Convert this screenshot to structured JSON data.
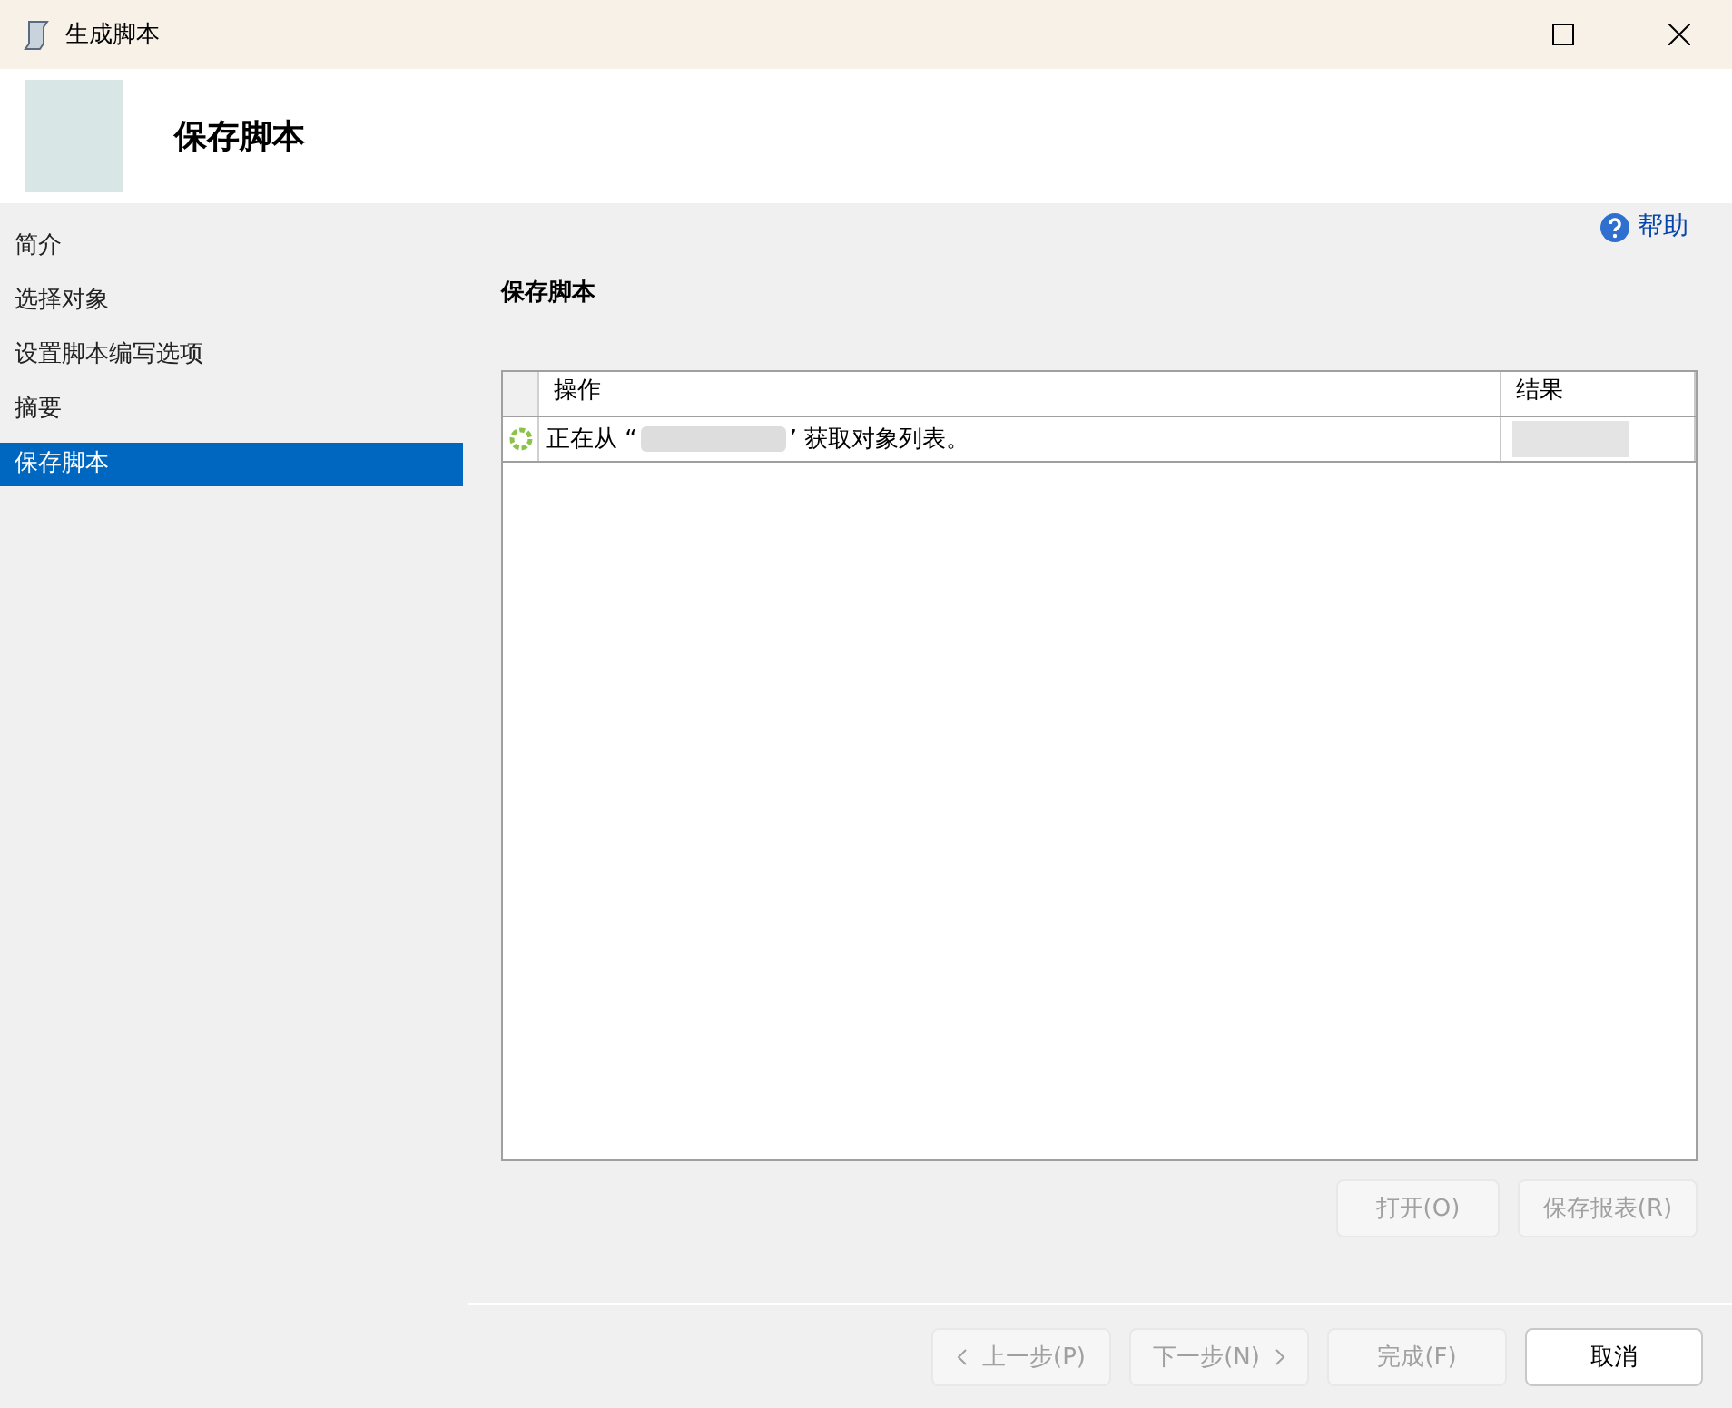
{
  "window": {
    "title": "生成脚本"
  },
  "header": {
    "title": "保存脚本"
  },
  "sidebar": {
    "items": [
      {
        "label": "简介",
        "selected": false
      },
      {
        "label": "选择对象",
        "selected": false
      },
      {
        "label": "设置脚本编写选项",
        "selected": false
      },
      {
        "label": "摘要",
        "selected": false
      },
      {
        "label": "保存脚本",
        "selected": true
      }
    ]
  },
  "help": {
    "label": "帮助"
  },
  "section_title": "保存脚本",
  "table": {
    "columns": [
      "操作",
      "结果"
    ],
    "rows": [
      {
        "in_progress": true,
        "message_prefix": "正在从 “",
        "message_suffix": "’ 获取对象列表。"
      }
    ]
  },
  "report_buttons": [
    {
      "label": "打开(O)",
      "disabled": true
    },
    {
      "label": "保存报表(R)",
      "disabled": true
    }
  ],
  "nav_buttons": [
    {
      "kind": "prev",
      "label": "上一步(P)",
      "disabled": true
    },
    {
      "kind": "next",
      "label": "下一步(N)",
      "disabled": true
    },
    {
      "kind": "plain",
      "label": "完成(F)",
      "disabled": true
    },
    {
      "kind": "plain",
      "label": "取消",
      "disabled": false
    }
  ]
}
